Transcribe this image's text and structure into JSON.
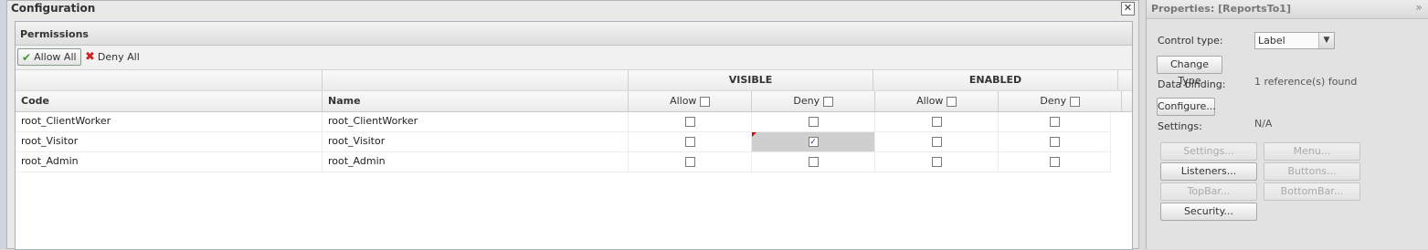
{
  "dialog": {
    "title": "Configuration",
    "close_symbol": "✕",
    "permissions_title": "Permissions",
    "toolbar": {
      "allow_all": "Allow All",
      "deny_all": "Deny All"
    }
  },
  "grid": {
    "group_headers": {
      "visible": "VISIBLE",
      "enabled": "ENABLED"
    },
    "columns": {
      "code": "Code",
      "name": "Name",
      "visible_allow": "Allow",
      "visible_deny": "Deny",
      "enabled_allow": "Allow",
      "enabled_deny": "Deny"
    },
    "rows": [
      {
        "code": "root_ClientWorker",
        "name": "root_ClientWorker",
        "visible_allow": false,
        "visible_deny": false,
        "enabled_allow": false,
        "enabled_deny": false
      },
      {
        "code": "root_Visitor",
        "name": "root_Visitor",
        "visible_allow": false,
        "visible_deny": true,
        "enabled_allow": false,
        "enabled_deny": false
      },
      {
        "code": "root_Admin",
        "name": "root_Admin",
        "visible_allow": false,
        "visible_deny": false,
        "enabled_allow": false,
        "enabled_deny": false
      }
    ]
  },
  "properties": {
    "title": "Properties: [ReportsTo1]",
    "collapse_symbol": "»",
    "control_type_label": "Control type:",
    "control_type_value": "Label",
    "change_type_button": "Change Type",
    "data_binding_label": "Data binding:",
    "data_binding_value": "1 reference(s) found",
    "configure_button": "Configure...",
    "settings_label": "Settings:",
    "settings_value": "N/A",
    "buttons": {
      "settings": "Settings...",
      "menu": "Menu...",
      "listeners": "Listeners...",
      "buttons": "Buttons...",
      "topbar": "TopBar...",
      "bottombar": "BottomBar...",
      "security": "Security..."
    }
  }
}
